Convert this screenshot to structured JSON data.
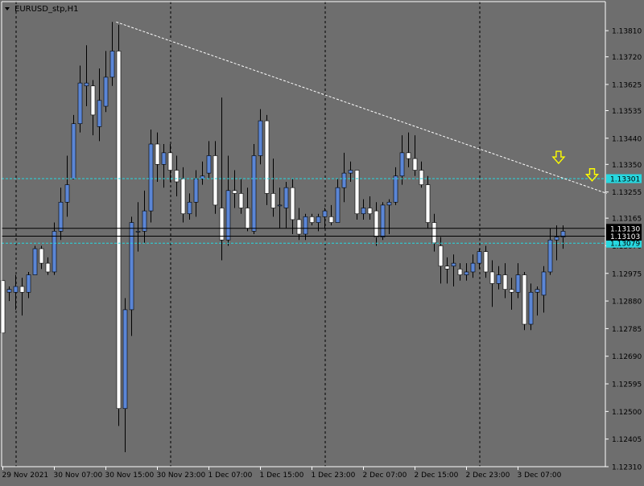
{
  "window": {
    "title": "EURUSD_stp,H1"
  },
  "colors": {
    "background": "#6e6e6e",
    "bull_fill": "#5b86d6",
    "bear_fill": "#ffffff",
    "wick": "#000000",
    "axis": "#ffffff",
    "grid": "#000000",
    "trendline": "#ffffff",
    "hline_cyan": "#27d8e0",
    "arrow": "#ffff00",
    "label_cyan_bg": "#27d8e0",
    "label_black_bg": "#000000"
  },
  "chart_data": {
    "type": "candlestick",
    "title": "EURUSD_stp,H1",
    "ylim": [
      1.1231,
      1.1391
    ],
    "y_ticks": [
      "1.13810",
      "1.13720",
      "1.13625",
      "1.13535",
      "1.13440",
      "1.13350",
      "1.13255",
      "1.13165",
      "1.13070",
      "1.12975",
      "1.12880",
      "1.12785",
      "1.12690",
      "1.12595",
      "1.12500",
      "1.12405",
      "1.12310"
    ],
    "x_ticks": [
      "29 Nov 2021",
      "30 Nov 07:00",
      "30 Nov 15:00",
      "30 Nov 23:00",
      "1 Dec 07:00",
      "1 Dec 15:00",
      "1 Dec 23:00",
      "2 Dec 07:00",
      "2 Dec 15:00",
      "2 Dec 23:00",
      "3 Dec 07:00"
    ],
    "x_tick_bars": [
      0,
      8,
      16,
      24,
      32,
      40,
      48,
      56,
      64,
      72,
      80
    ],
    "period_separators_bars": [
      1,
      25,
      49,
      73
    ],
    "candles": [
      [
        1.1295,
        1.1291,
        1.1277,
        1.1277
      ],
      [
        1.1291,
        1.1293,
        1.1288,
        1.1292
      ],
      [
        1.1291,
        1.1297,
        1.1285,
        1.1293
      ],
      [
        1.1293,
        1.1296,
        1.1283,
        1.1291
      ],
      [
        1.1291,
        1.1298,
        1.1289,
        1.1297
      ],
      [
        1.1297,
        1.1307,
        1.1297,
        1.1306
      ],
      [
        1.1306,
        1.1307,
        1.1299,
        1.1301
      ],
      [
        1.1301,
        1.1303,
        1.1297,
        1.1298
      ],
      [
        1.1298,
        1.1315,
        1.1297,
        1.1312
      ],
      [
        1.1312,
        1.1327,
        1.1309,
        1.1322
      ],
      [
        1.1322,
        1.1338,
        1.1317,
        1.1328
      ],
      [
        1.133,
        1.1352,
        1.133,
        1.1349
      ],
      [
        1.1349,
        1.1369,
        1.1346,
        1.1363
      ],
      [
        1.1362,
        1.1376,
        1.1355,
        1.1363
      ],
      [
        1.1362,
        1.1364,
        1.1345,
        1.1352
      ],
      [
        1.1348,
        1.1368,
        1.1343,
        1.1357
      ],
      [
        1.1355,
        1.1374,
        1.1353,
        1.1365
      ],
      [
        1.1365,
        1.1384,
        1.1362,
        1.1374
      ],
      [
        1.1374,
        1.1383,
        1.1245,
        1.1251
      ],
      [
        1.1251,
        1.1289,
        1.1236,
        1.1285
      ],
      [
        1.1285,
        1.1317,
        1.1276,
        1.1315
      ],
      [
        1.1312,
        1.1322,
        1.1305,
        1.1312
      ],
      [
        1.1312,
        1.1326,
        1.1308,
        1.1319
      ],
      [
        1.1319,
        1.1347,
        1.1315,
        1.1342
      ],
      [
        1.1342,
        1.1346,
        1.1329,
        1.1335
      ],
      [
        1.1335,
        1.1342,
        1.1327,
        1.1339
      ],
      [
        1.1339,
        1.1342,
        1.1329,
        1.1333
      ],
      [
        1.1333,
        1.1338,
        1.1324,
        1.1329
      ],
      [
        1.133,
        1.1334,
        1.1315,
        1.1318
      ],
      [
        1.1318,
        1.1325,
        1.1316,
        1.1322
      ],
      [
        1.1322,
        1.1333,
        1.1317,
        1.133
      ],
      [
        1.133,
        1.1336,
        1.1328,
        1.1331
      ],
      [
        1.1332,
        1.1343,
        1.133,
        1.1338
      ],
      [
        1.1338,
        1.1343,
        1.1318,
        1.1321
      ],
      [
        1.132,
        1.1358,
        1.1302,
        1.1309
      ],
      [
        1.1309,
        1.1338,
        1.1307,
        1.1326
      ],
      [
        1.1326,
        1.1333,
        1.132,
        1.1325
      ],
      [
        1.1325,
        1.133,
        1.1318,
        1.132
      ],
      [
        1.132,
        1.1327,
        1.1312,
        1.1313
      ],
      [
        1.1312,
        1.1342,
        1.1311,
        1.1338
      ],
      [
        1.1338,
        1.1354,
        1.1335,
        1.135
      ],
      [
        1.135,
        1.1352,
        1.1321,
        1.1325
      ],
      [
        1.1325,
        1.1337,
        1.1317,
        1.132
      ],
      [
        1.1321,
        1.1327,
        1.1313,
        1.1321
      ],
      [
        1.132,
        1.1329,
        1.1313,
        1.1327
      ],
      [
        1.1327,
        1.133,
        1.1311,
        1.1316
      ],
      [
        1.1316,
        1.132,
        1.1309,
        1.1311
      ],
      [
        1.1311,
        1.1318,
        1.1309,
        1.1317
      ],
      [
        1.1317,
        1.1318,
        1.1314,
        1.1315
      ],
      [
        1.1315,
        1.1318,
        1.1312,
        1.1317
      ],
      [
        1.1317,
        1.132,
        1.1313,
        1.1319
      ],
      [
        1.1317,
        1.1321,
        1.1314,
        1.1315
      ],
      [
        1.1315,
        1.133,
        1.1315,
        1.1327
      ],
      [
        1.1327,
        1.1339,
        1.1322,
        1.1332
      ],
      [
        1.1332,
        1.1336,
        1.1329,
        1.1333
      ],
      [
        1.1333,
        1.133,
        1.1316,
        1.1318
      ],
      [
        1.1318,
        1.1323,
        1.1316,
        1.132
      ],
      [
        1.132,
        1.1324,
        1.1316,
        1.1318
      ],
      [
        1.1319,
        1.1322,
        1.1307,
        1.131
      ],
      [
        1.131,
        1.1322,
        1.1309,
        1.1321
      ],
      [
        1.1321,
        1.1323,
        1.1311,
        1.1322
      ],
      [
        1.1322,
        1.1334,
        1.1321,
        1.1331
      ],
      [
        1.1331,
        1.1345,
        1.1328,
        1.1339
      ],
      [
        1.1339,
        1.1346,
        1.1334,
        1.1337
      ],
      [
        1.1337,
        1.1345,
        1.1331,
        1.1333
      ],
      [
        1.1333,
        1.1336,
        1.1327,
        1.1328
      ],
      [
        1.1328,
        1.1331,
        1.1313,
        1.1315
      ],
      [
        1.1315,
        1.1318,
        1.1305,
        1.1308
      ],
      [
        1.1307,
        1.131,
        1.1294,
        1.13
      ],
      [
        1.13,
        1.1303,
        1.1294,
        1.1299
      ],
      [
        1.13,
        1.1304,
        1.1293,
        1.1301
      ],
      [
        1.1299,
        1.1301,
        1.1295,
        1.1297
      ],
      [
        1.1297,
        1.1301,
        1.1295,
        1.1298
      ],
      [
        1.1298,
        1.1304,
        1.1296,
        1.1301
      ],
      [
        1.1301,
        1.1306,
        1.1299,
        1.1305
      ],
      [
        1.1305,
        1.1307,
        1.1296,
        1.1298
      ],
      [
        1.1298,
        1.1302,
        1.1286,
        1.1294
      ],
      [
        1.1294,
        1.13,
        1.1292,
        1.1297
      ],
      [
        1.1297,
        1.1301,
        1.1289,
        1.1292
      ],
      [
        1.1292,
        1.1296,
        1.1285,
        1.1291
      ],
      [
        1.1291,
        1.1301,
        1.1289,
        1.1297
      ],
      [
        1.1297,
        1.1298,
        1.1278,
        1.128
      ],
      [
        1.128,
        1.1294,
        1.1278,
        1.1291
      ],
      [
        1.1291,
        1.1293,
        1.1283,
        1.1292
      ],
      [
        1.129,
        1.13,
        1.1284,
        1.1298
      ],
      [
        1.1298,
        1.1313,
        1.1297,
        1.1309
      ],
      [
        1.1309,
        1.1314,
        1.1302,
        1.131
      ],
      [
        1.131,
        1.1314,
        1.1306,
        1.1312
      ]
    ],
    "horizontal_lines": [
      {
        "price": 1.13301,
        "style": "dashed",
        "color": "#27d8e0",
        "label": "1.13301"
      },
      {
        "price": 1.13079,
        "style": "dashed",
        "color": "#27d8e0",
        "label": "1.13079"
      },
      {
        "price": 1.1313,
        "style": "solid",
        "color": "#000000",
        "label": "1.13130"
      },
      {
        "price": 1.13103,
        "style": "solid",
        "color": "#000000",
        "label": "1.13103"
      }
    ],
    "trendline": {
      "from": [
        17.6,
        1.1384
      ],
      "to": [
        93.8,
        1.1325
      ],
      "style": "dotted"
    },
    "arrows": [
      {
        "bar": 86.3,
        "price": 1.1337,
        "direction": "down"
      },
      {
        "bar": 91.5,
        "price": 1.1331,
        "direction": "down"
      }
    ],
    "grid": false
  }
}
